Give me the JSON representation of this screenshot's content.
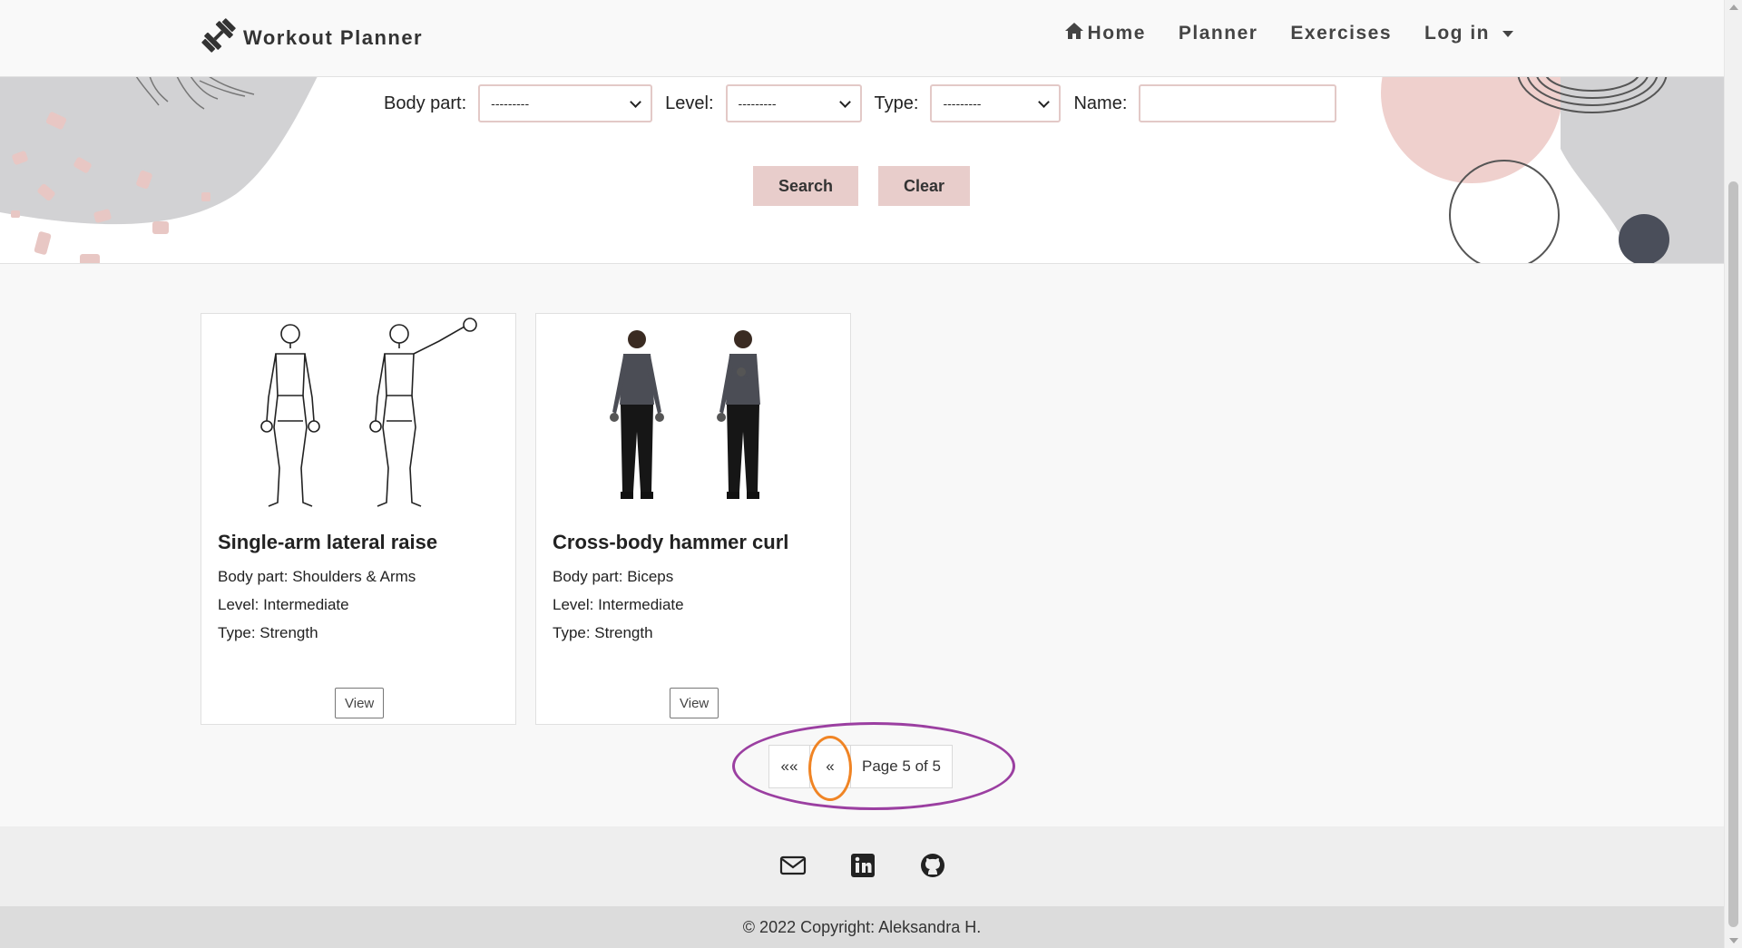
{
  "brand": {
    "name": "Workout Planner",
    "icon": "dumbbell-icon"
  },
  "nav": {
    "home": "Home",
    "planner": "Planner",
    "exercises": "Exercises",
    "login": "Log in"
  },
  "filters": {
    "body_part_label": "Body part:",
    "body_part_value": "---------",
    "level_label": "Level:",
    "level_value": "---------",
    "type_label": "Type:",
    "type_value": "---------",
    "name_label": "Name:",
    "name_value": "",
    "search_button": "Search",
    "clear_button": "Clear"
  },
  "cards": [
    {
      "title": "Single-arm lateral raise",
      "body_part": "Body part: Shoulders & Arms",
      "level": "Level: Intermediate",
      "type": "Type: Strength",
      "view": "View",
      "image": "line-drawing-woman-lateral-raise"
    },
    {
      "title": "Cross-body hammer curl",
      "body_part": "Body part: Biceps",
      "level": "Level: Intermediate",
      "type": "Type: Strength",
      "view": "View",
      "image": "photo-man-hammer-curl"
    }
  ],
  "pagination": {
    "first": "««",
    "prev": "«",
    "status": "Page 5 of 5"
  },
  "footer": {
    "icons": [
      "envelope-icon",
      "linkedin-icon",
      "github-icon"
    ],
    "copyright": "© 2022 Copyright: Aleksandra H."
  },
  "colors": {
    "accent": "#e8cdcb",
    "highlight_purple": "#9b3fa1",
    "highlight_orange": "#f08424"
  }
}
